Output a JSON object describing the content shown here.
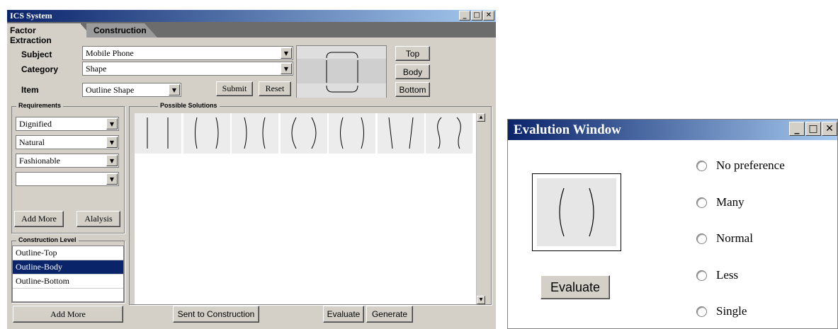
{
  "main_window": {
    "title": "ICS System",
    "tabs": [
      "Factor Extraction",
      "Construction"
    ],
    "labels": {
      "subject": "Subject",
      "category": "Category",
      "item": "Item"
    },
    "subject_value": "Mobile Phone",
    "category_value": "Shape",
    "item_value": "Outline Shape",
    "submit": "Submit",
    "reset": "Reset",
    "part_buttons": [
      "Top",
      "Body",
      "Bottom"
    ],
    "requirements_title": "Requirements",
    "requirements": [
      "Dignified",
      "Natural",
      "Fashionable",
      ""
    ],
    "add_more": "Add More",
    "analysis": "Alalysis",
    "construction_level_title": "Construction Level",
    "levels": [
      "Outline-Top",
      "Outline-Body",
      "Outline-Bottom"
    ],
    "add_more_bottom": "Add More",
    "solutions_title": "Possible Solutions",
    "sent_to_construction": "Sent to Construction",
    "evaluate": "Evaluate",
    "generate": "Generate"
  },
  "eval_window": {
    "title": "Evalution Window",
    "evaluate": "Evaluate",
    "options": [
      "No preference",
      "Many",
      "Normal",
      "Less",
      "Single"
    ]
  },
  "colors": {
    "titlebar": "#0a246a",
    "selected": "#0a246a",
    "window_bg": "#d4d0c8"
  }
}
